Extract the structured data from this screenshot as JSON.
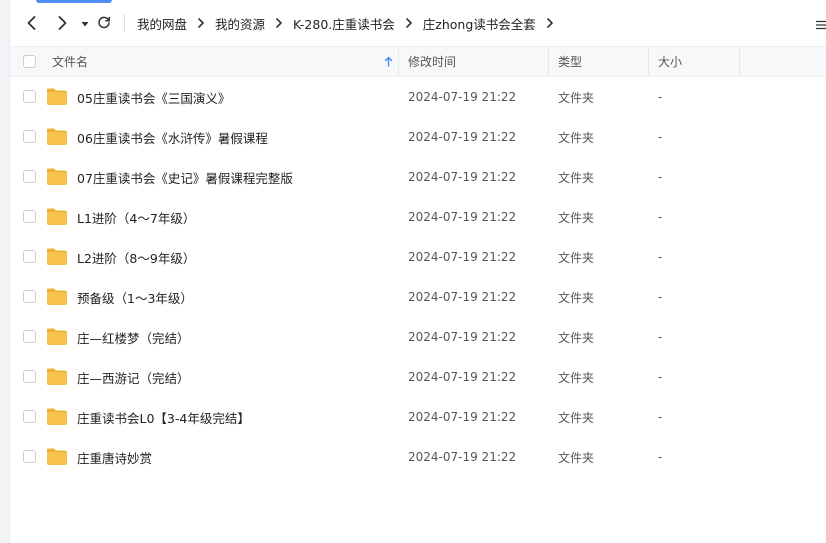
{
  "toolbar": {
    "back_icon": "chevron-left-icon",
    "forward_icon": "chevron-right-icon",
    "history_icon": "caret-down-icon",
    "refresh_icon": "refresh-icon",
    "menu_icon": "list-menu-icon"
  },
  "breadcrumb": [
    "我的网盘",
    "我的资源",
    "K-280.庄重读书会",
    "庄zhong读书会全套"
  ],
  "columns": {
    "name": "文件名",
    "modified": "修改时间",
    "type": "类型",
    "size": "大小"
  },
  "colors": {
    "accent": "#4f8ef7",
    "folder": "#f7c24a",
    "folder_tab": "#eeb13a"
  },
  "files": [
    {
      "name": "05庄重读书会《三国演义》",
      "modified": "2024-07-19 21:22",
      "type": "文件夹",
      "size": "-"
    },
    {
      "name": "06庄重读书会《水浒传》暑假课程",
      "modified": "2024-07-19 21:22",
      "type": "文件夹",
      "size": "-"
    },
    {
      "name": "07庄重读书会《史记》暑假课程完整版",
      "modified": "2024-07-19 21:22",
      "type": "文件夹",
      "size": "-"
    },
    {
      "name": "L1进阶（4～7年级）",
      "modified": "2024-07-19 21:22",
      "type": "文件夹",
      "size": "-"
    },
    {
      "name": "L2进阶（8～9年级）",
      "modified": "2024-07-19 21:22",
      "type": "文件夹",
      "size": "-"
    },
    {
      "name": "预备级（1～3年级）",
      "modified": "2024-07-19 21:22",
      "type": "文件夹",
      "size": "-"
    },
    {
      "name": "庄—红楼梦（完结）",
      "modified": "2024-07-19 21:22",
      "type": "文件夹",
      "size": "-"
    },
    {
      "name": "庄—西游记（完结）",
      "modified": "2024-07-19 21:22",
      "type": "文件夹",
      "size": "-"
    },
    {
      "name": "庄重读书会L0【3-4年级完结】",
      "modified": "2024-07-19 21:22",
      "type": "文件夹",
      "size": "-"
    },
    {
      "name": "庄重唐诗妙赏",
      "modified": "2024-07-19 21:22",
      "type": "文件夹",
      "size": "-"
    }
  ]
}
